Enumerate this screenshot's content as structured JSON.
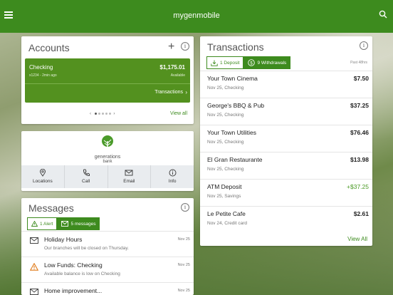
{
  "app": {
    "title": "mygenmobile"
  },
  "accounts": {
    "heading": "Accounts",
    "add_icon": "+",
    "account": {
      "name": "Checking",
      "sub": "x1234 - 2min ago",
      "balance": "$1,175.01",
      "balance_label": "Available",
      "transactions_link": "Transactions"
    },
    "view_all": "View all",
    "pager": {
      "pages": 5,
      "current": 1
    }
  },
  "bank": {
    "logo_line1": "generations",
    "logo_line2": "bank",
    "actions": [
      {
        "label": "Locations",
        "icon": "location-pin-icon"
      },
      {
        "label": "Call",
        "icon": "phone-icon"
      },
      {
        "label": "Email",
        "icon": "envelope-icon"
      },
      {
        "label": "Info",
        "icon": "info-icon"
      }
    ]
  },
  "messages": {
    "heading": "Messages",
    "alert_btn": "1 Alert",
    "messages_btn": "5 messages",
    "items": [
      {
        "title": "Holiday Hours",
        "sub": "Our branches will be closed on Thursday.",
        "date": "Nov 25",
        "icon": "envelope-icon"
      },
      {
        "title": "Low Funds: Checking",
        "sub": "Available balance is low on Checking",
        "date": "Nov 25",
        "icon": "warning-icon"
      },
      {
        "title": "Home improvement...",
        "sub": "",
        "date": "Nov 25",
        "icon": "envelope-icon"
      }
    ]
  },
  "transactions": {
    "heading": "Transactions",
    "deposit_btn": "1 Deposit",
    "withdrawal_btn": "9 Withdrawals",
    "period": "Past 48hrs",
    "items": [
      {
        "merchant": "Your Town Cinema",
        "sub": "Nov 25, Checking",
        "amount": "$7.50"
      },
      {
        "merchant": "George's BBQ & Pub",
        "sub": "Nov 25, Checking",
        "amount": "$37.25"
      },
      {
        "merchant": "Your Town Utilities",
        "sub": "Nov 25, Checking",
        "amount": "$76.46"
      },
      {
        "merchant": "El Gran Restaurante",
        "sub": "Nov 25, Checking",
        "amount": "$13.98"
      },
      {
        "merchant": "ATM Deposit",
        "sub": "Nov 25, Savings",
        "amount": "+$37.25"
      },
      {
        "merchant": "Le Petite Cafe",
        "sub": "Nov 24, Credit card",
        "amount": "$2.61"
      }
    ],
    "view_all": "View All"
  },
  "colors": {
    "brand": "#3d8b1e",
    "card_green": "#53911f",
    "positive": "#4a9a25"
  }
}
